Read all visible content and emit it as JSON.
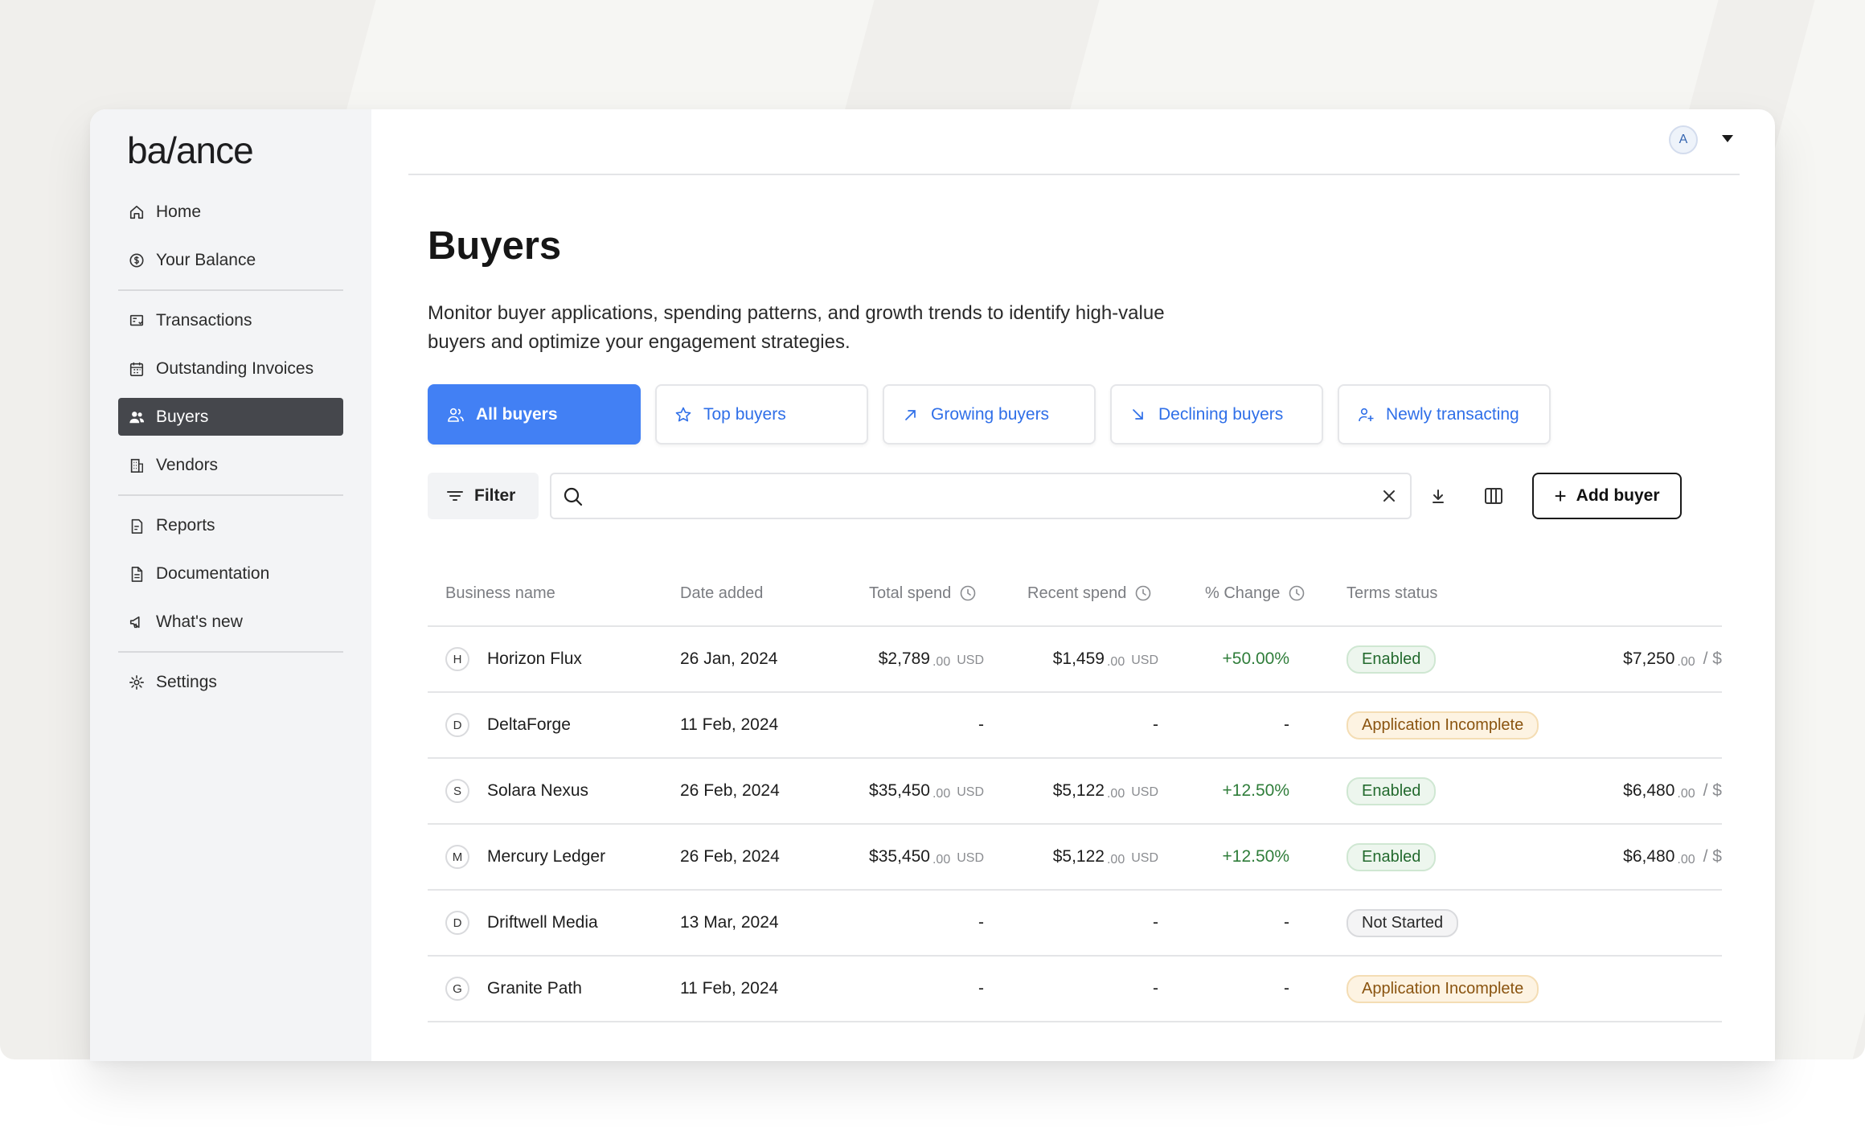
{
  "app": {
    "logo": "ba/ance"
  },
  "sidebar": {
    "groups": [
      [
        {
          "label": "Home",
          "icon": "home-icon"
        },
        {
          "label": "Your Balance",
          "icon": "dollar-circle-icon"
        }
      ],
      [
        {
          "label": "Transactions",
          "icon": "transactions-icon"
        },
        {
          "label": "Outstanding Invoices",
          "icon": "calendar-icon"
        },
        {
          "label": "Buyers",
          "icon": "users-icon",
          "active": true
        },
        {
          "label": "Vendors",
          "icon": "building-icon"
        }
      ],
      [
        {
          "label": "Reports",
          "icon": "reports-icon"
        },
        {
          "label": "Documentation",
          "icon": "document-icon"
        },
        {
          "label": "What's new",
          "icon": "megaphone-icon"
        }
      ],
      [
        {
          "label": "Settings",
          "icon": "gear-icon"
        }
      ]
    ]
  },
  "header": {
    "avatar_initial": "A"
  },
  "page": {
    "title": "Buyers",
    "subtitle": "Monitor buyer applications, spending patterns, and growth trends to identify high-value buyers and optimize your engagement strategies."
  },
  "tabs": [
    {
      "label": "All buyers",
      "icon": "users-icon",
      "active": true
    },
    {
      "label": "Top buyers",
      "icon": "star-icon"
    },
    {
      "label": "Growing buyers",
      "icon": "arrow-up-right-icon"
    },
    {
      "label": "Declining buyers",
      "icon": "arrow-down-right-icon"
    },
    {
      "label": "Newly transacting",
      "icon": "user-plus-icon"
    }
  ],
  "toolbar": {
    "filter_label": "Filter",
    "search_value": "",
    "add_label": "Add buyer"
  },
  "table": {
    "columns": [
      "Business name",
      "Date added",
      "Total spend",
      "Recent spend",
      "% Change",
      "Terms status"
    ],
    "rows": [
      {
        "initial": "H",
        "name": "Horizon Flux",
        "date": "26 Jan, 2024",
        "total": "$2,789",
        "total_cents": ".00",
        "total_cur": "USD",
        "recent": "$1,459",
        "recent_cents": ".00",
        "recent_cur": "USD",
        "change": "+50.00%",
        "status": "Enabled",
        "status_type": "enabled",
        "limit": "$7,250",
        "limit_cents": ".00",
        "limit_rest": "/ $"
      },
      {
        "initial": "D",
        "name": "DeltaForge",
        "date": "11 Feb, 2024",
        "total": "-",
        "recent": "-",
        "change": "-",
        "status": "Application Incomplete",
        "status_type": "incomplete"
      },
      {
        "initial": "S",
        "name": "Solara Nexus",
        "date": "26 Feb, 2024",
        "total": "$35,450",
        "total_cents": ".00",
        "total_cur": "USD",
        "recent": "$5,122",
        "recent_cents": ".00",
        "recent_cur": "USD",
        "change": "+12.50%",
        "status": "Enabled",
        "status_type": "enabled",
        "limit": "$6,480",
        "limit_cents": ".00",
        "limit_rest": "/ $"
      },
      {
        "initial": "M",
        "name": "Mercury Ledger",
        "date": "26 Feb, 2024",
        "total": "$35,450",
        "total_cents": ".00",
        "total_cur": "USD",
        "recent": "$5,122",
        "recent_cents": ".00",
        "recent_cur": "USD",
        "change": "+12.50%",
        "status": "Enabled",
        "status_type": "enabled",
        "limit": "$6,480",
        "limit_cents": ".00",
        "limit_rest": "/ $"
      },
      {
        "initial": "D",
        "name": "Driftwell Media",
        "date": "13 Mar, 2024",
        "total": "-",
        "recent": "-",
        "change": "-",
        "status": "Not Started",
        "status_type": "notstarted"
      },
      {
        "initial": "G",
        "name": "Granite Path",
        "date": "11 Feb, 2024",
        "total": "-",
        "recent": "-",
        "change": "-",
        "status": "Application Incomplete",
        "status_type": "incomplete"
      }
    ]
  },
  "colors": {
    "accent": "#4280f4",
    "tab_text": "#2f6fe8",
    "positive": "#2f7d3a",
    "sidebar_bg": "#f3f4f6",
    "active_nav": "#45474c"
  }
}
